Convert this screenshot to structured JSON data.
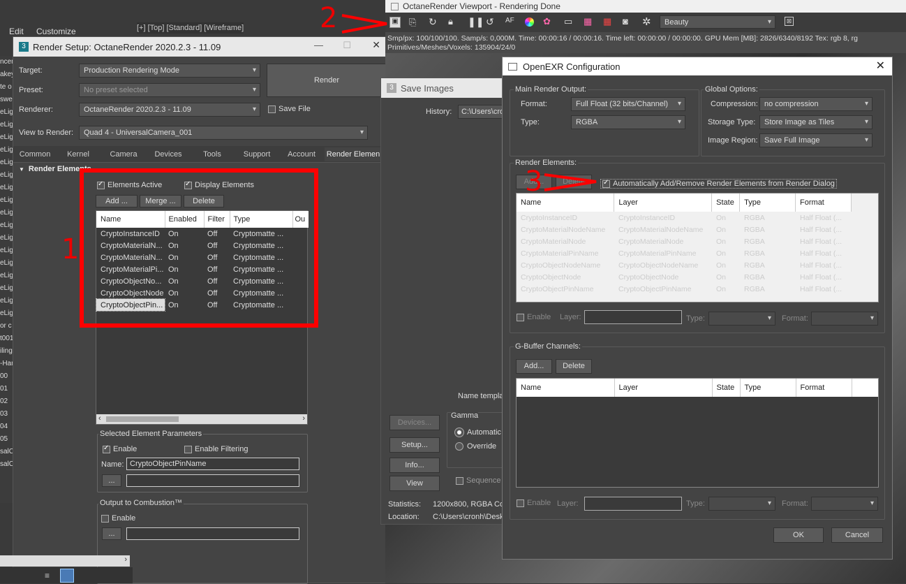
{
  "app_menu": {
    "edit": "Edit",
    "customize": "Customize"
  },
  "viewport_label": "[+] [Top] [Standard] [Wireframe]",
  "left_strip": [
    "ncen",
    "akey",
    "te o",
    "swel",
    "eLig",
    "eLig",
    "eLig",
    "eLig",
    "eLig",
    "eLig",
    "eLig",
    "eLig",
    "eLig",
    "eLig",
    "eLig",
    "eLig",
    "eLig",
    "eLig",
    "eLig",
    "eLig",
    "eLig",
    "or c",
    "t001",
    "iling",
    "-Ham",
    "00",
    "01",
    "02",
    "03",
    "04",
    "05",
    "salC",
    "salC"
  ],
  "render_setup": {
    "title": "Render Setup: OctaneRender 2020.2.3 - 11.09",
    "target_label": "Target:",
    "target_value": "Production Rendering Mode",
    "preset_label": "Preset:",
    "preset_value": "No preset selected",
    "renderer_label": "Renderer:",
    "renderer_value": "OctaneRender 2020.2.3 - 11.09",
    "save_file": "Save File",
    "view_label": "View to Render:",
    "view_value": "Quad 4 - UniversalCamera_001",
    "render_button": "Render",
    "tabs": [
      "Common",
      "Kernel",
      "Camera",
      "Devices",
      "Tools",
      "Support",
      "Account",
      "Render Elemen"
    ],
    "rollout_title": "Render Elements",
    "elements_active": "Elements Active",
    "display_elements": "Display Elements",
    "add": "Add ...",
    "merge": "Merge ...",
    "delete": "Delete",
    "columns": [
      "Name",
      "Enabled",
      "Filter",
      "Type",
      "Ou"
    ],
    "rows": [
      [
        "CryptoInstanceID",
        "On",
        "Off",
        "Cryptomatte ..."
      ],
      [
        "CryptoMaterialN...",
        "On",
        "Off",
        "Cryptomatte ..."
      ],
      [
        "CryptoMaterialN...",
        "On",
        "Off",
        "Cryptomatte ..."
      ],
      [
        "CryptoMaterialPi...",
        "On",
        "Off",
        "Cryptomatte ..."
      ],
      [
        "CryptoObjectNo...",
        "On",
        "Off",
        "Cryptomatte ..."
      ],
      [
        "CryptoObjectNode",
        "On",
        "Off",
        "Cryptomatte ..."
      ],
      [
        "CryptoObjectPin...",
        "On",
        "Off",
        "Cryptomatte ..."
      ]
    ],
    "selected_params": "Selected Element Parameters",
    "enable": "Enable",
    "enable_filtering": "Enable Filtering",
    "name_label": "Name:",
    "name_value": "CryptoObjectPinName",
    "browse": "...",
    "combustion": "Output to Combustion™",
    "combustion_enable": "Enable"
  },
  "viewport": {
    "title": "OctaneRender Viewport - Rendering Done",
    "pass": "Beauty",
    "stats1": "Smp/px: 100/100/100.   Samp/s: 0,000M.   Time: 00:00:16 / 00:00:16.   Time left: 00:00:00 / 00:00:00.   GPU Mem [MB]: 2826/6340/8192   Tex: rgb 8, rg",
    "stats2": "Primitives/Meshes/Voxels: 135904/24/0"
  },
  "save_images": {
    "title": "Save Images",
    "history_label": "History:",
    "history_value": "C:\\Users\\cron",
    "name_template": "Name templa",
    "devices": "Devices...",
    "setup": "Setup...",
    "info": "Info...",
    "view": "View",
    "gamma": "Gamma",
    "automatic": "Automatic",
    "override": "Override",
    "sequence": "Sequence",
    "statistics_label": "Statistics:",
    "statistics_value": "1200x800, RGBA Col",
    "location_label": "Location:",
    "location_value": "C:\\Users\\cronh\\Desk"
  },
  "openexr": {
    "title": "OpenEXR Configuration",
    "main_output": "Main Render Output:",
    "format_label": "Format:",
    "format_value": "Full Float (32 bits/Channel)",
    "type_label": "Type:",
    "type_value": "RGBA",
    "global_options": "Global Options:",
    "compression_label": "Compression:",
    "compression_value": "no compression",
    "storage_label": "Storage Type:",
    "storage_value": "Store Image as Tiles",
    "region_label": "Image Region:",
    "region_value": "Save Full Image",
    "render_elements": "Render Elements:",
    "add": "Add...",
    "delete": "Delete",
    "auto_add": "Automatically Add/Remove Render Elements from Render Dialog",
    "columns": [
      "Name",
      "Layer",
      "State",
      "Type",
      "Format"
    ],
    "rows": [
      [
        "CryptoInstanceID",
        "CryptoInstanceID",
        "On",
        "RGBA",
        "Half Float (..."
      ],
      [
        "CryptoMaterialNodeName",
        "CryptoMaterialNodeName",
        "On",
        "RGBA",
        "Half Float (..."
      ],
      [
        "CryptoMaterialNode",
        "CryptoMaterialNode",
        "On",
        "RGBA",
        "Half Float (..."
      ],
      [
        "CryptoMaterialPinName",
        "CryptoMaterialPinName",
        "On",
        "RGBA",
        "Half Float (..."
      ],
      [
        "CryptoObjectNodeName",
        "CryptoObjectNodeName",
        "On",
        "RGBA",
        "Half Float (..."
      ],
      [
        "CryptoObjectNode",
        "CryptoObjectNode",
        "On",
        "RGBA",
        "Half Float (..."
      ],
      [
        "CryptoObjectPinName",
        "CryptoObjectPinName",
        "On",
        "RGBA",
        "Half Float (..."
      ]
    ],
    "enable": "Enable",
    "layer": "Layer:",
    "type": "Type:",
    "format": "Format:",
    "gbuffer": "G-Buffer Channels:",
    "ok": "OK",
    "cancel": "Cancel"
  },
  "annotations": [
    "1",
    "2",
    "3"
  ],
  "colors": {
    "annotation": "#ff0000",
    "dialog_bg": "#444444"
  }
}
